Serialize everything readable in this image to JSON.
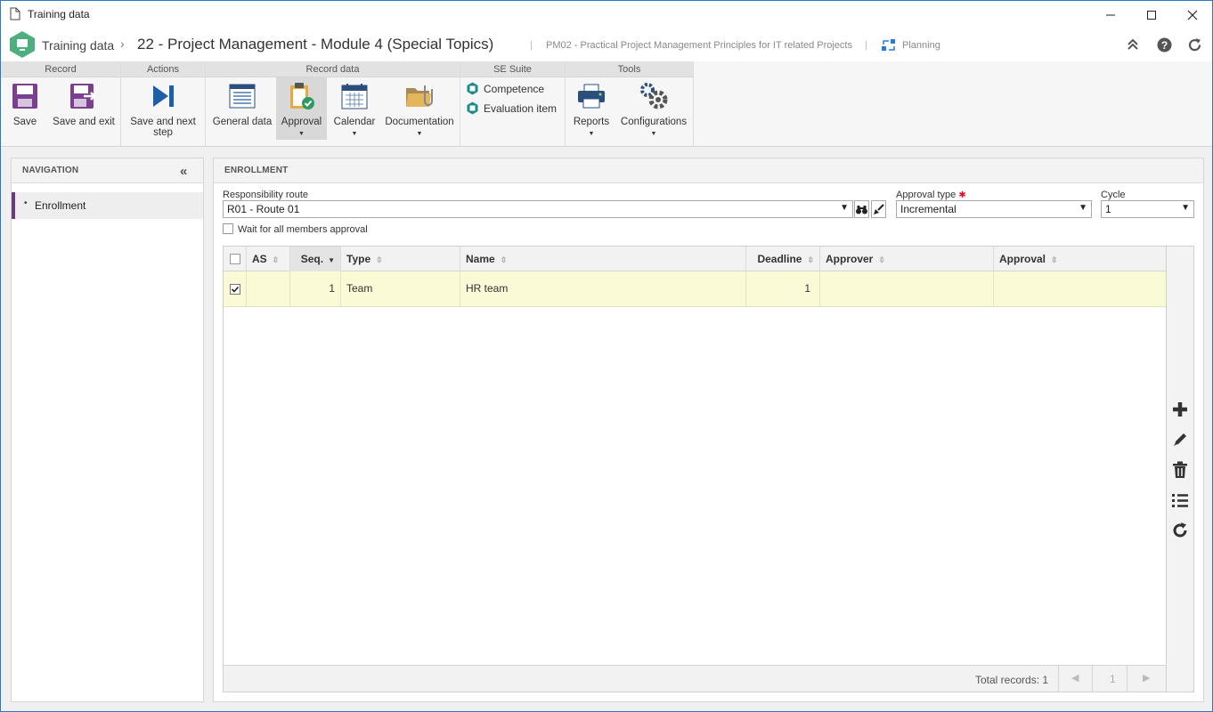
{
  "window": {
    "title": "Training data",
    "controls": {
      "minimize": "minimize-icon",
      "maximize": "maximize-icon",
      "close": "close-icon"
    }
  },
  "header": {
    "app_name": "Training data",
    "record_title": "22 - Project Management - Module 4 (Special Topics)",
    "course": "PM02 - Practical Project Management Principles for IT related Projects",
    "stage": "Planning"
  },
  "ribbon": {
    "groups": {
      "record": "Record",
      "actions": "Actions",
      "record_data": "Record data",
      "se_suite": "SE Suite",
      "tools": "Tools"
    },
    "buttons": {
      "save": "Save",
      "save_exit": "Save and exit",
      "save_next_line1": "Save and next",
      "save_next_line2": "step",
      "general_data": "General data",
      "approval": "Approval",
      "calendar": "Calendar",
      "documentation": "Documentation",
      "competence": "Competence",
      "evaluation_item": "Evaluation item",
      "reports": "Reports",
      "configurations": "Configurations"
    }
  },
  "navigation": {
    "title": "NAVIGATION",
    "items": [
      {
        "label": "Enrollment",
        "selected": true
      }
    ]
  },
  "enrollment": {
    "title": "ENROLLMENT",
    "responsibility_route_label": "Responsibility route",
    "responsibility_route_value": "R01 - Route 01",
    "approval_type_label": "Approval type",
    "approval_type_value": "Incremental",
    "cycle_label": "Cycle",
    "cycle_value": "1",
    "wait_all_label": "Wait for all members approval",
    "wait_all_checked": false
  },
  "grid": {
    "columns": [
      "AS",
      "Seq.",
      "Type",
      "Name",
      "Deadline",
      "Approver",
      "Approval"
    ],
    "sorted_column": "Seq.",
    "rows": [
      {
        "checked": true,
        "as": "",
        "seq": "1",
        "type": "Team",
        "name": "HR team",
        "deadline": "1",
        "approver": "",
        "approval": ""
      }
    ],
    "footer": {
      "total_records": "Total records: 1",
      "page": "1"
    }
  },
  "colors": {
    "accent_purple": "#7b3f8f",
    "teal": "#1a8a8a",
    "row_highlight": "#fafbd6",
    "required": "#e0102d"
  }
}
